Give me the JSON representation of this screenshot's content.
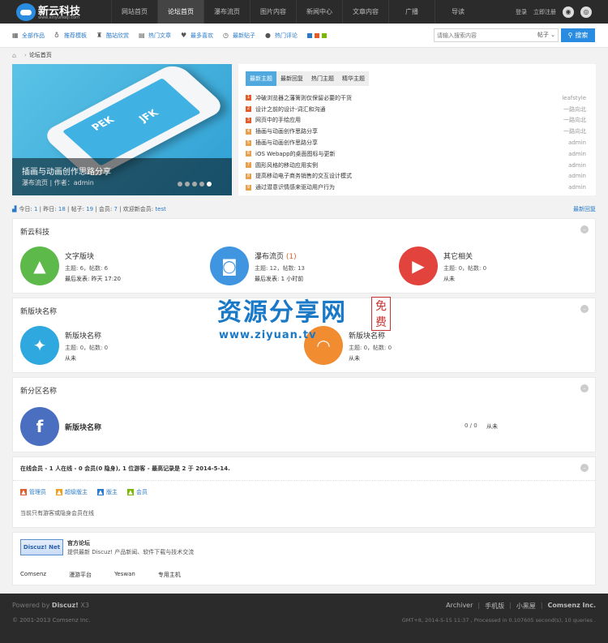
{
  "brand": {
    "title": "新云科技",
    "subtitle": "www.xinyunkeji.com"
  },
  "nav": [
    "网站首页",
    "论坛首页",
    "瀑布流页",
    "图片内容",
    "新闻中心",
    "文章内容",
    "广播",
    "导读"
  ],
  "top_links": {
    "login": "登录",
    "register": "立即注册"
  },
  "subnav": [
    {
      "icon": "grid-icon",
      "label": "全部作品"
    },
    {
      "icon": "bulb-icon",
      "label": "推荐模板"
    },
    {
      "icon": "trophy-icon",
      "label": "酷站欣赏"
    },
    {
      "icon": "doc-icon",
      "label": "热门文章"
    },
    {
      "icon": "heart-icon",
      "label": "最多喜欢"
    },
    {
      "icon": "clock-icon",
      "label": "最新贴子"
    },
    {
      "icon": "chat-icon",
      "label": "热门评论"
    }
  ],
  "theme_colors": [
    "#2a7ac9",
    "#e35d2a",
    "#7ab800"
  ],
  "search": {
    "placeholder": "请输入搜索内容",
    "scope": "帖子",
    "button": "搜索"
  },
  "breadcrumb": {
    "current": "论坛首页"
  },
  "slider": {
    "title": "插画与动画创作思路分享",
    "meta": "瀑布流页 | 作者：admin",
    "dots": 5,
    "active_dot": 5,
    "phone_text": [
      "PEK",
      "JFK"
    ]
  },
  "tabs": [
    "最新主题",
    "最新回复",
    "热门主题",
    "精华主题"
  ],
  "topics": [
    {
      "n": "1",
      "title": "冲破浏览器之藩篱则仅保留必要的干货",
      "author": "leafstyle"
    },
    {
      "n": "2",
      "title": "设计之前的设计-词汇和沟通",
      "author": "一路向北"
    },
    {
      "n": "3",
      "title": "网页中的手绘应用",
      "author": "一路向北"
    },
    {
      "n": "4",
      "title": "插画与动画创作思路分享",
      "author": "一路向北"
    },
    {
      "n": "5",
      "title": "插画与动画创作思路分享",
      "author": "admin"
    },
    {
      "n": "6",
      "title": "iOS Webapp的桌面图标与更新",
      "author": "admin"
    },
    {
      "n": "7",
      "title": "圆形风格的移动应用实例",
      "author": "admin"
    },
    {
      "n": "8",
      "title": "提高移动电子商务销售的交互设计模式",
      "author": "admin"
    },
    {
      "n": "9",
      "title": "通过潜意识情感来驱动用户行为",
      "author": "admin"
    }
  ],
  "stats": {
    "today_label": "今日:",
    "today": "1",
    "yesterday_label": "昨日:",
    "yesterday": "18",
    "posts_label": "帖子:",
    "posts": "19",
    "members_label": "会员:",
    "members": "7",
    "welcome_label": "欢迎新会员:",
    "welcome": "test",
    "latest_reply": "最新回复"
  },
  "groups": [
    {
      "name": "新云科技",
      "forums": [
        {
          "icon": "tree-icon",
          "color": "#5eb94b",
          "name": "文字版块",
          "count": "",
          "stat": "主题: 6，帖数: 6",
          "last": "最后发表: 昨天 17:20"
        },
        {
          "icon": "camera-icon",
          "color": "#3f95e0",
          "name": "瀑布流页",
          "count": "(1)",
          "stat": "主题: 12，帖数: 13",
          "last": "最后发表: 1 小时前"
        },
        {
          "icon": "play-icon",
          "color": "#e2433d",
          "name": "其它相关",
          "count": "",
          "stat": "主题: 0，帖数: 0",
          "last": "从未"
        }
      ]
    },
    {
      "name": "新版块名称",
      "forums": [
        {
          "icon": "twitter-icon",
          "color": "#2fa8e0",
          "name": "新版块名称",
          "count": "",
          "stat": "主题: 0，帖数: 0",
          "last": "从未"
        },
        {
          "icon": "rss-icon",
          "color": "#f18c31",
          "name": "新版块名称",
          "count": "",
          "stat": "主题: 0，帖数: 0",
          "last": "从未"
        }
      ]
    },
    {
      "name": "新分区名称",
      "forums": [
        {
          "icon": "facebook-icon",
          "color": "#4a6fc1",
          "name": "新版块名称",
          "count": "0 / 0",
          "stat": "",
          "last": "从未"
        }
      ]
    }
  ],
  "online": {
    "label": "在线会员 - 1 人在线 - 0 会员(0 隐身), 1 位游客 - 最高记录是 2 于 2014-5-14.",
    "legend": [
      {
        "icon": "admin-icon",
        "color": "#e35d2a",
        "label": "管理员"
      },
      {
        "icon": "supermod-icon",
        "color": "#f0a020",
        "label": "超级版主"
      },
      {
        "icon": "mod-icon",
        "color": "#2a7ac9",
        "label": "版主"
      },
      {
        "icon": "member-icon",
        "color": "#7ab800",
        "label": "会员"
      }
    ],
    "note": "当前只有游客或隐身会员在线"
  },
  "links": {
    "logo_text": "Discuz! Net",
    "title": "官方论坛",
    "desc": "提供最新 Discuz! 产品新闻、软件下载与技术交流",
    "items": [
      "Comsenz",
      "漫游平台",
      "Yeswan",
      "专用主机"
    ]
  },
  "watermark": {
    "main": "资源分享网",
    "url": "www.ziyuan.tv",
    "seal": [
      "免",
      "费"
    ]
  },
  "footer": {
    "powered": "Powered by",
    "product": "Discuz!",
    "version": "X3",
    "copyright": "© 2001-2013 Comsenz Inc.",
    "links": [
      "Archiver",
      "手机版",
      "小黑屋",
      "Comsenz Inc."
    ],
    "gmt": "GMT+8, 2014-5-15 11:37 , Processed in 0.107605 second(s), 10 queries ."
  }
}
